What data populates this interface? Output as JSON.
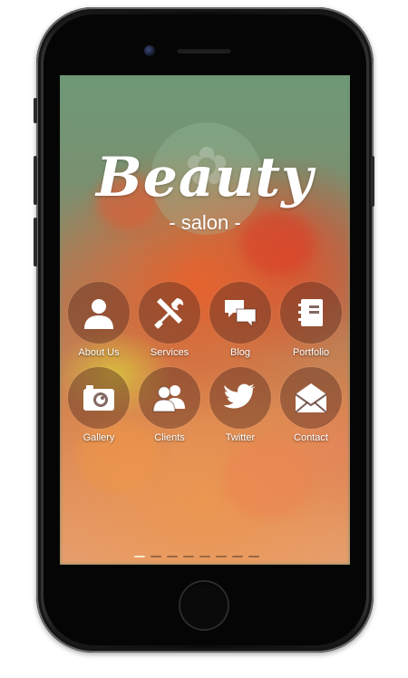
{
  "app": {
    "title": "Beauty",
    "subtitle": "- salon -"
  },
  "menu": [
    {
      "label": "About Us",
      "icon": "user-icon"
    },
    {
      "label": "Services",
      "icon": "tools-icon"
    },
    {
      "label": "Blog",
      "icon": "chat-icon"
    },
    {
      "label": "Portfolio",
      "icon": "notebook-icon"
    },
    {
      "label": "Gallery",
      "icon": "camera-icon"
    },
    {
      "label": "Clients",
      "icon": "users-icon"
    },
    {
      "label": "Twitter",
      "icon": "twitter-bird-icon"
    },
    {
      "label": "Contact",
      "icon": "envelope-icon"
    }
  ],
  "pager": {
    "pages": 8,
    "active_index": 0
  },
  "colors": {
    "tile_overlay": "#50281e",
    "label_text": "#ffffff",
    "pager_active": "#f6e6cc"
  }
}
